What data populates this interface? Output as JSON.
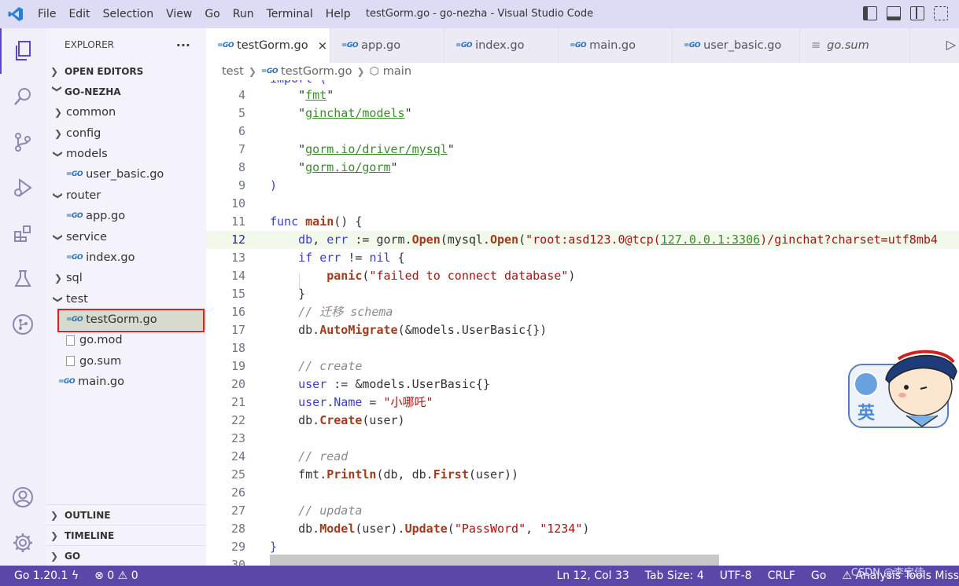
{
  "app": {
    "window_title": "testGorm.go - go-nezha - Visual Studio Code",
    "menu": [
      "File",
      "Edit",
      "Selection",
      "View",
      "Go",
      "Run",
      "Terminal",
      "Help"
    ]
  },
  "colors": {
    "titlebar": "#dddcf5",
    "statusbar": "#5a48a8",
    "selection_outline": "#e02020",
    "keyword": "#3c3ccf",
    "function": "#a03c1b",
    "string_link": "#3e8c2e"
  },
  "activity_bar": [
    "explorer-icon",
    "search-icon",
    "source-control-icon",
    "run-debug-icon",
    "extensions-icon",
    "testing-icon",
    "git-graph-icon",
    "account-icon",
    "settings-gear-icon"
  ],
  "sidebar": {
    "header": "EXPLORER",
    "more": "···",
    "open_editors": "OPEN EDITORS",
    "root": "GO-NEZHA",
    "tree": [
      {
        "label": "common",
        "type": "folder",
        "expanded": false
      },
      {
        "label": "config",
        "type": "folder",
        "expanded": false
      },
      {
        "label": "models",
        "type": "folder",
        "expanded": true
      },
      {
        "label": "user_basic.go",
        "type": "go"
      },
      {
        "label": "router",
        "type": "folder",
        "expanded": true
      },
      {
        "label": "app.go",
        "type": "go"
      },
      {
        "label": "service",
        "type": "folder",
        "expanded": true
      },
      {
        "label": "index.go",
        "type": "go"
      },
      {
        "label": "sql",
        "type": "folder",
        "expanded": false
      },
      {
        "label": "test",
        "type": "folder",
        "expanded": true
      },
      {
        "label": "testGorm.go",
        "type": "go",
        "selected": true
      },
      {
        "label": "go.mod",
        "type": "file"
      },
      {
        "label": "go.sum",
        "type": "file"
      },
      {
        "label": "main.go",
        "type": "go"
      }
    ],
    "outline": "OUTLINE",
    "timeline": "TIMELINE",
    "go": "GO"
  },
  "tabs": [
    {
      "label": "testGorm.go",
      "active": true,
      "close": "×"
    },
    {
      "label": "app.go"
    },
    {
      "label": "index.go"
    },
    {
      "label": "main.go"
    },
    {
      "label": "user_basic.go"
    },
    {
      "label": "go.sum"
    }
  ],
  "breadcrumb": {
    "folder": "test",
    "file": "testGorm.go",
    "symbol": "main"
  },
  "editor": {
    "partial_top_line": "import (",
    "lines": [
      {
        "n": "4"
      },
      {
        "n": "5"
      },
      {
        "n": "6"
      },
      {
        "n": "7"
      },
      {
        "n": "8"
      },
      {
        "n": "9"
      },
      {
        "n": "10"
      },
      {
        "n": "11"
      },
      {
        "n": "12"
      },
      {
        "n": "13"
      },
      {
        "n": "14"
      },
      {
        "n": "15"
      },
      {
        "n": "16"
      },
      {
        "n": "17"
      },
      {
        "n": "18"
      },
      {
        "n": "19"
      },
      {
        "n": "20"
      },
      {
        "n": "21"
      },
      {
        "n": "22"
      },
      {
        "n": "23"
      },
      {
        "n": "24"
      },
      {
        "n": "25"
      },
      {
        "n": "26"
      },
      {
        "n": "27"
      },
      {
        "n": "28"
      },
      {
        "n": "29"
      },
      {
        "n": "30"
      }
    ],
    "current_line": 12,
    "strings": {
      "fmt": "fmt",
      "models": "ginchat/models",
      "mysql": "gorm.io/driver/mysql",
      "gorm": "gorm.io/gorm",
      "dsn_a": "\"root:asd123.0@tcp(",
      "dsn_host": "127.0.0.1:3306",
      "dsn_b": ")/ginchat?charset=utf8mb4",
      "fail": "\"failed to connect database\"",
      "name": "\"小哪吒\"",
      "pw_key": "\"PassWord\"",
      "pw_val": "\"1234\""
    },
    "comments": {
      "migrate": "// 迁移 schema",
      "create": "// create",
      "read": "// read",
      "update": "// updata"
    }
  },
  "ime": {
    "char": "英"
  },
  "statusbar": {
    "go_version": "Go 1.20.1",
    "errors": "0",
    "warnings": "0",
    "position": "Ln 12, Col 33",
    "tab_size": "Tab Size: 4",
    "encoding": "UTF-8",
    "eol": "CRLF",
    "language": "Go",
    "analysis": "Analysis Tools Miss",
    "watermark": "CSDN @李宝佳"
  }
}
